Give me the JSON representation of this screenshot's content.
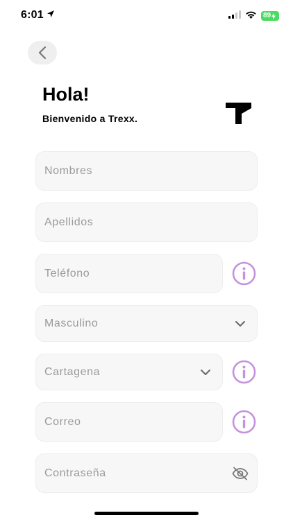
{
  "status_bar": {
    "time": "6:01",
    "battery": "89"
  },
  "header": {
    "title": "Hola!",
    "subtitle": "Bienvenido a Trexx."
  },
  "form": {
    "nombres_placeholder": "Nombres",
    "apellidos_placeholder": "Apellidos",
    "telefono_placeholder": "Teléfono",
    "genero_value": "Masculino",
    "ciudad_value": "Cartagena",
    "correo_placeholder": "Correo",
    "contrasena_placeholder": "Contraseña"
  },
  "colors": {
    "accent_info": "#c592e0",
    "field_bg": "#f7f7f7",
    "placeholder": "#9a9a9a"
  },
  "icons": {
    "back": "chevron-left-icon",
    "info": "info-circle-icon",
    "dropdown": "chevron-down-icon",
    "password": "eye-slash-icon"
  }
}
